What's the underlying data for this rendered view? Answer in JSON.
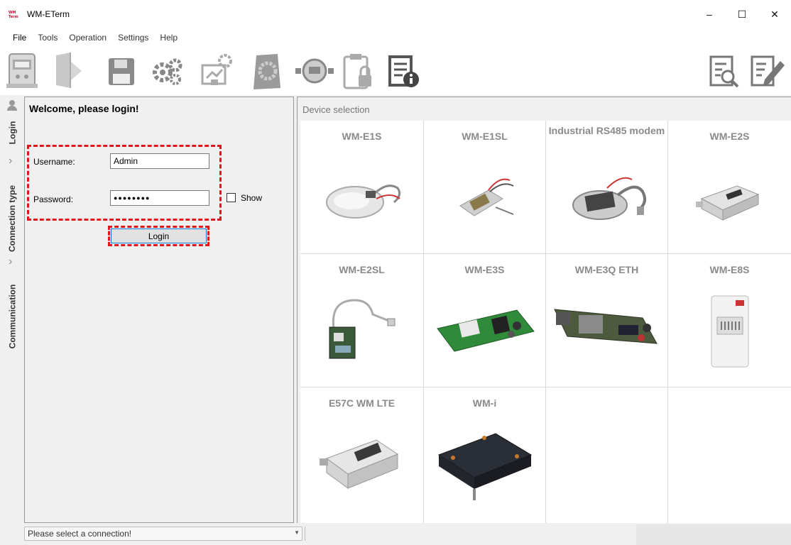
{
  "window": {
    "title": "WM-ETerm",
    "minimize": "–",
    "maximize": "☐",
    "close": "✕"
  },
  "menu": [
    "File",
    "Tools",
    "Operation",
    "Settings",
    "Help"
  ],
  "toolbar": {
    "icons": [
      "meter-icon",
      "folder-open-icon",
      "save-icon",
      "settings-gears-icon",
      "configure-device-icon",
      "firmware-update-icon",
      "meter-connection-icon",
      "locked-clipboard-icon",
      "document-info-icon",
      "document-search-icon",
      "document-edit-icon"
    ]
  },
  "sidetabs": [
    {
      "label": "Login",
      "icon": "user-icon"
    },
    {
      "label": "Connection type",
      "icon": "chevron-right-icon"
    },
    {
      "label": "Communication",
      "icon": "chevron-right-icon"
    }
  ],
  "login": {
    "title": "Welcome, please login!",
    "username_label": "Username:",
    "username_value": "Admin",
    "password_label": "Password:",
    "password_value": "●●●●●●●●",
    "show_label": "Show",
    "show_checked": false,
    "login_button": "Login",
    "highlight_color": "#e0161b"
  },
  "devices": {
    "title": "Device selection",
    "items": [
      {
        "name": "WM-E1S",
        "image": "clear-housing-modem"
      },
      {
        "name": "WM-E1SL",
        "image": "small-modem-board"
      },
      {
        "name": "Industrial RS485 modem",
        "image": "rs485-modem"
      },
      {
        "name": "WM-E2S",
        "image": "din-rail-modem"
      },
      {
        "name": "WM-E2SL",
        "image": "pcb-with-antenna"
      },
      {
        "name": "WM-E3S",
        "image": "green-pcb"
      },
      {
        "name": "WM-E3Q ETH",
        "image": "ethernet-pcb"
      },
      {
        "name": "WM-E8S",
        "image": "white-meter-modem"
      },
      {
        "name": "E57C WM LTE",
        "image": "grey-lte-box"
      },
      {
        "name": "WM-i",
        "image": "black-waterproof-box"
      }
    ]
  },
  "status": {
    "connection_text": "Please select a connection!"
  },
  "colors": {
    "accent": "#0078d7",
    "highlight": "#e0161b",
    "device_label": "#8a8a8a"
  }
}
